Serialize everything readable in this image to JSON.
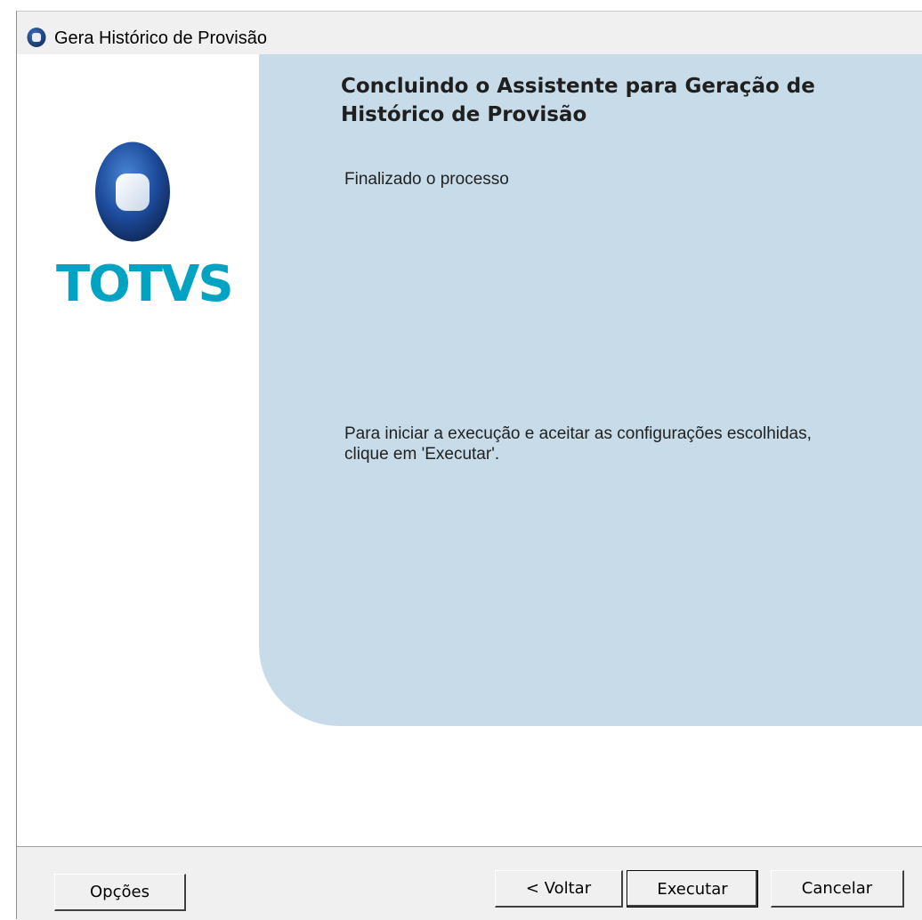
{
  "window": {
    "title": "Gera Histórico de Provisão",
    "icon": "totvs-logo-icon"
  },
  "brand": {
    "logo_text": "TOTVS",
    "logo_color": "#00a4c2",
    "mark_color": "#1f3f7f"
  },
  "wizard": {
    "heading": "Concluindo o Assistente para Geração de Histórico de Provisão",
    "status": "Finalizado o processo",
    "instruction": "Para iniciar a execução e aceitar as configurações escolhidas, clique em 'Executar'.",
    "panel_color": "#c7dbe8"
  },
  "buttons": {
    "options": "Opções",
    "back": "< Voltar",
    "execute": "Executar",
    "cancel": "Cancelar"
  }
}
